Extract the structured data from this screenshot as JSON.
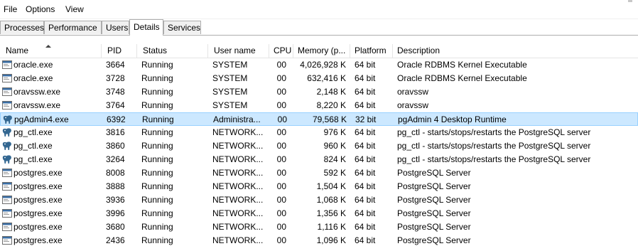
{
  "menu": [
    "File",
    "Options",
    "View"
  ],
  "tabs": [
    {
      "label": "Processes",
      "active": false
    },
    {
      "label": "Performance",
      "active": false
    },
    {
      "label": "Users",
      "active": false
    },
    {
      "label": "Details",
      "active": true
    },
    {
      "label": "Services",
      "active": false
    }
  ],
  "columns": [
    "Name",
    "PID",
    "Status",
    "User name",
    "CPU",
    "Memory (p...",
    "Platform",
    "Description"
  ],
  "rows": [
    {
      "icon": "window-app-icon",
      "name": "oracle.exe",
      "pid": "3664",
      "status": "Running",
      "user": "SYSTEM",
      "cpu": "00",
      "memory": "4,026,928 K",
      "platform": "64 bit",
      "description": "Oracle RDBMS Kernel Executable"
    },
    {
      "icon": "window-app-icon",
      "name": "oracle.exe",
      "pid": "3728",
      "status": "Running",
      "user": "SYSTEM",
      "cpu": "00",
      "memory": "632,416 K",
      "platform": "64 bit",
      "description": "Oracle RDBMS Kernel Executable"
    },
    {
      "icon": "window-app-icon",
      "name": "oravssw.exe",
      "pid": "3748",
      "status": "Running",
      "user": "SYSTEM",
      "cpu": "00",
      "memory": "2,148 K",
      "platform": "64 bit",
      "description": "oravssw"
    },
    {
      "icon": "window-app-icon",
      "name": "oravssw.exe",
      "pid": "3764",
      "status": "Running",
      "user": "SYSTEM",
      "cpu": "00",
      "memory": "8,220 K",
      "platform": "64 bit",
      "description": "oravssw"
    },
    {
      "icon": "elephant-icon",
      "name": "pgAdmin4.exe",
      "pid": "6392",
      "status": "Running",
      "user": "Administra...",
      "cpu": "00",
      "memory": "79,568 K",
      "platform": "32 bit",
      "description": "pgAdmin 4 Desktop Runtime",
      "selected": true
    },
    {
      "icon": "elephant-icon",
      "name": "pg_ctl.exe",
      "pid": "3816",
      "status": "Running",
      "user": "NETWORK...",
      "cpu": "00",
      "memory": "976 K",
      "platform": "64 bit",
      "description": "pg_ctl - starts/stops/restarts the PostgreSQL server"
    },
    {
      "icon": "elephant-icon",
      "name": "pg_ctl.exe",
      "pid": "3860",
      "status": "Running",
      "user": "NETWORK...",
      "cpu": "00",
      "memory": "960 K",
      "platform": "64 bit",
      "description": "pg_ctl - starts/stops/restarts the PostgreSQL server"
    },
    {
      "icon": "elephant-icon",
      "name": "pg_ctl.exe",
      "pid": "3264",
      "status": "Running",
      "user": "NETWORK...",
      "cpu": "00",
      "memory": "824 K",
      "platform": "64 bit",
      "description": "pg_ctl - starts/stops/restarts the PostgreSQL server"
    },
    {
      "icon": "window-app-icon",
      "name": "postgres.exe",
      "pid": "8008",
      "status": "Running",
      "user": "NETWORK...",
      "cpu": "00",
      "memory": "592 K",
      "platform": "64 bit",
      "description": "PostgreSQL Server"
    },
    {
      "icon": "window-app-icon",
      "name": "postgres.exe",
      "pid": "3888",
      "status": "Running",
      "user": "NETWORK...",
      "cpu": "00",
      "memory": "1,504 K",
      "platform": "64 bit",
      "description": "PostgreSQL Server"
    },
    {
      "icon": "window-app-icon",
      "name": "postgres.exe",
      "pid": "3936",
      "status": "Running",
      "user": "NETWORK...",
      "cpu": "00",
      "memory": "1,068 K",
      "platform": "64 bit",
      "description": "PostgreSQL Server"
    },
    {
      "icon": "window-app-icon",
      "name": "postgres.exe",
      "pid": "3996",
      "status": "Running",
      "user": "NETWORK...",
      "cpu": "00",
      "memory": "1,356 K",
      "platform": "64 bit",
      "description": "PostgreSQL Server"
    },
    {
      "icon": "window-app-icon",
      "name": "postgres.exe",
      "pid": "3680",
      "status": "Running",
      "user": "NETWORK...",
      "cpu": "00",
      "memory": "1,116 K",
      "platform": "64 bit",
      "description": "PostgreSQL Server"
    },
    {
      "icon": "window-app-icon",
      "name": "postgres.exe",
      "pid": "2436",
      "status": "Running",
      "user": "NETWORK...",
      "cpu": "00",
      "memory": "1,096 K",
      "platform": "64 bit",
      "description": "PostgreSQL Server"
    }
  ],
  "colors": {
    "selected_bg": "#cce8ff",
    "selected_border": "#99d1ff",
    "elephant": "#336791"
  }
}
